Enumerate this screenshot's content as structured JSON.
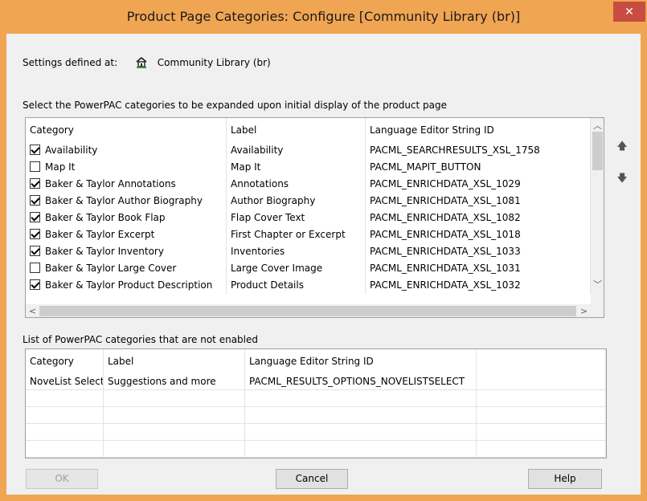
{
  "window": {
    "title": "Product Page Categories: Configure [Community Library  (br)]",
    "close_glyph": "✕"
  },
  "settings": {
    "label": "Settings defined at:",
    "value": "Community Library  (br)",
    "icon": "home-icon"
  },
  "enabled": {
    "caption": "Select the PowerPAC categories to be expanded upon initial display of the product page",
    "columns": [
      "Category",
      "Label",
      "Language Editor String ID"
    ],
    "rows": [
      {
        "checked": true,
        "category": "Availability",
        "label": "Availability",
        "string_id": "PACML_SEARCHRESULTS_XSL_1758"
      },
      {
        "checked": false,
        "category": "Map It",
        "label": "Map It",
        "string_id": "PACML_MAPIT_BUTTON"
      },
      {
        "checked": true,
        "category": "Baker & Taylor Annotations",
        "label": "Annotations",
        "string_id": "PACML_ENRICHDATA_XSL_1029"
      },
      {
        "checked": true,
        "category": "Baker & Taylor Author Biography",
        "label": "Author Biography",
        "string_id": "PACML_ENRICHDATA_XSL_1081"
      },
      {
        "checked": true,
        "category": "Baker & Taylor Book Flap",
        "label": "Flap Cover Text",
        "string_id": "PACML_ENRICHDATA_XSL_1082"
      },
      {
        "checked": true,
        "category": "Baker & Taylor Excerpt",
        "label": "First Chapter or Excerpt",
        "string_id": "PACML_ENRICHDATA_XSL_1018"
      },
      {
        "checked": true,
        "category": "Baker & Taylor Inventory",
        "label": "Inventories",
        "string_id": "PACML_ENRICHDATA_XSL_1033"
      },
      {
        "checked": false,
        "category": "Baker & Taylor Large Cover",
        "label": "Large Cover Image",
        "string_id": "PACML_ENRICHDATA_XSL_1031"
      },
      {
        "checked": true,
        "category": "Baker & Taylor Product Description",
        "label": "Product Details",
        "string_id": "PACML_ENRICHDATA_XSL_1032"
      }
    ]
  },
  "disabled": {
    "caption": "List of PowerPAC categories that are not enabled",
    "columns": [
      "Category",
      "Label",
      "Language Editor String ID"
    ],
    "rows": [
      {
        "category": "NoveList Select",
        "label": "Suggestions and more",
        "string_id": "PACML_RESULTS_OPTIONS_NOVELISTSELECT"
      }
    ]
  },
  "buttons": {
    "ok": "OK",
    "cancel": "Cancel",
    "help": "Help"
  },
  "colors": {
    "title_bar": "#f0a553",
    "close": "#c94c42",
    "client": "#f0f0f0"
  }
}
